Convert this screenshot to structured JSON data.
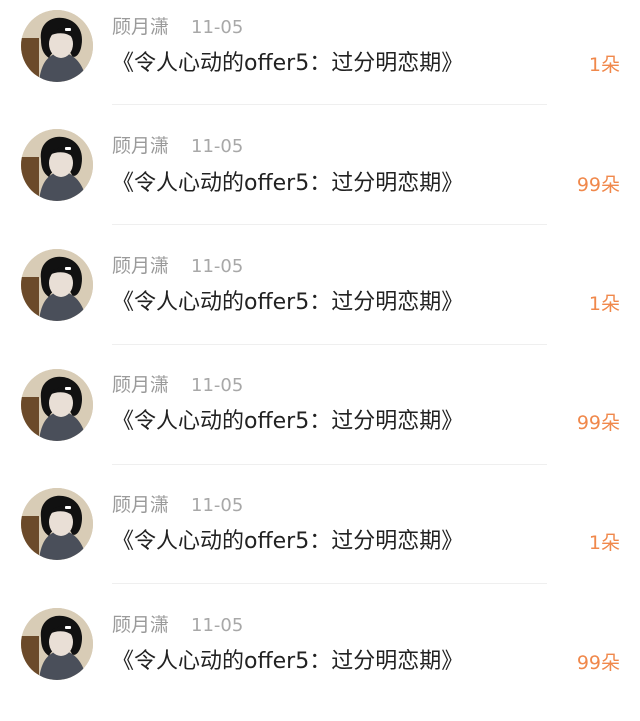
{
  "items": [
    {
      "name": "顾月潇",
      "date": "11-05",
      "title": "《令人心动的offer5：过分明恋期》",
      "count": "1朵"
    },
    {
      "name": "顾月潇",
      "date": "11-05",
      "title": "《令人心动的offer5：过分明恋期》",
      "count": "99朵"
    },
    {
      "name": "顾月潇",
      "date": "11-05",
      "title": "《令人心动的offer5：过分明恋期》",
      "count": "1朵"
    },
    {
      "name": "顾月潇",
      "date": "11-05",
      "title": "《令人心动的offer5：过分明恋期》",
      "count": "99朵"
    },
    {
      "name": "顾月潇",
      "date": "11-05",
      "title": "《令人心动的offer5：过分明恋期》",
      "count": "1朵"
    },
    {
      "name": "顾月潇",
      "date": "11-05",
      "title": "《令人心动的offer5：过分明恋期》",
      "count": "99朵"
    }
  ],
  "colors": {
    "name": "#9a9a9a",
    "date": "#a8a8a8",
    "title": "#222222",
    "count": "#f0884b",
    "divider": "#efefef"
  }
}
